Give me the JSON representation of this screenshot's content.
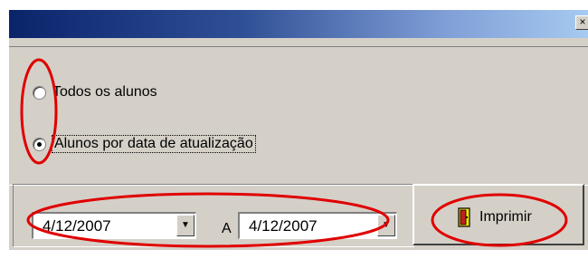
{
  "window": {
    "close_glyph": "×"
  },
  "options": [
    {
      "label": "Todos os alunos",
      "checked": false
    },
    {
      "label": "Alunos por data de atualização",
      "checked": true
    }
  ],
  "date_range": {
    "from": "4/12/2007",
    "separator": "A",
    "to": "4/12/2007",
    "dropdown_glyph": "▼"
  },
  "print_button": {
    "label": "Imprimir",
    "icon": "door-exit-icon"
  },
  "colors": {
    "annotation": "#e00000",
    "titlebar_start": "#0a246a",
    "titlebar_end": "#a6caf0",
    "face": "#d4d0c8"
  }
}
